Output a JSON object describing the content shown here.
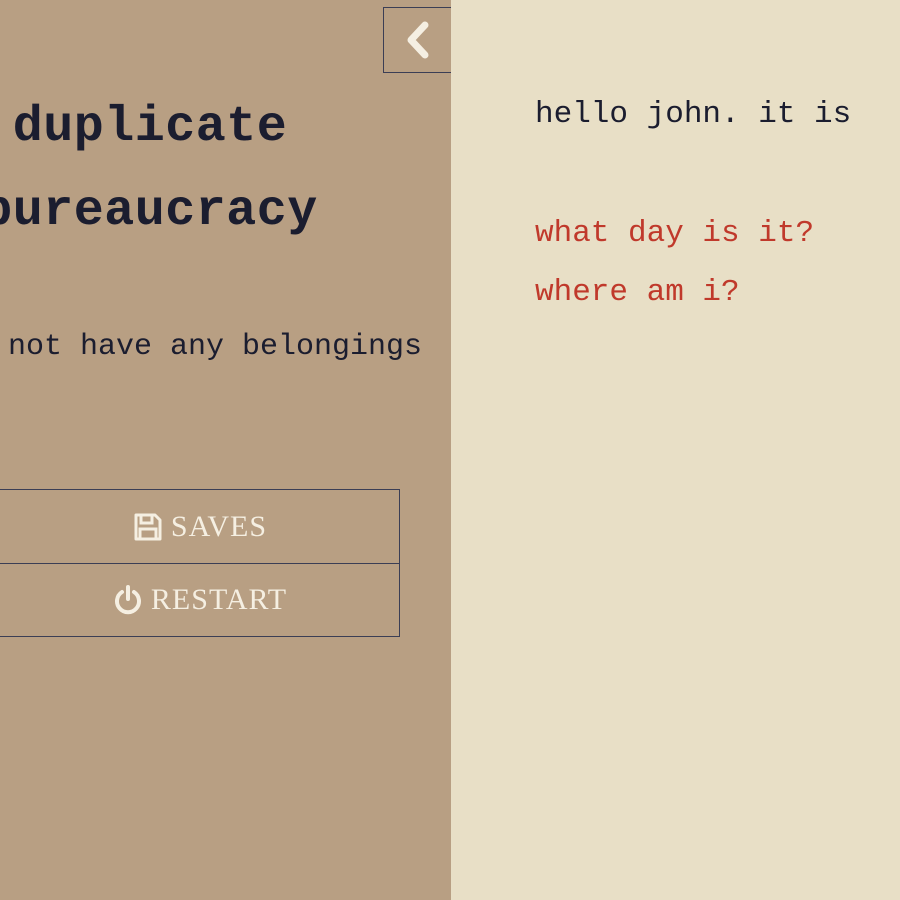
{
  "sidebar": {
    "title_line1": "duplicate",
    "title_line2": "bureaucracy",
    "inventory_text": "you do not have any belongings",
    "buttons": {
      "saves_label": "SAVES",
      "restart_label": "RESTART"
    },
    "icons": {
      "collapse": "chevron-left-icon",
      "saves": "floppy-disk-icon",
      "restart": "power-icon"
    }
  },
  "story": {
    "text": "hello john. it is",
    "choices": [
      "what day is it?",
      "where am i?"
    ]
  },
  "colors": {
    "sidebar_bg": "#b89f83",
    "page_bg": "#e8dfc6",
    "text": "#1b1d2f",
    "choice": "#c0392b",
    "button_text": "#f5efe2"
  }
}
